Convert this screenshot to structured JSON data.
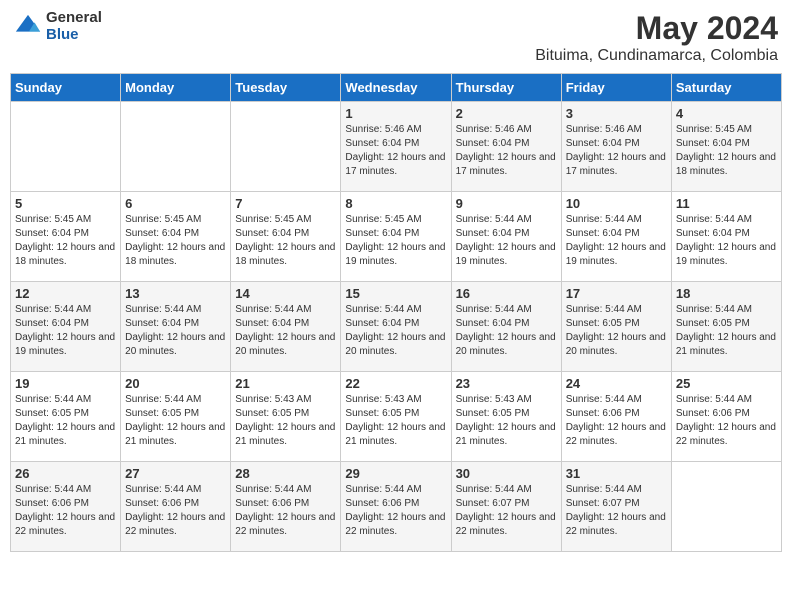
{
  "logo": {
    "general": "General",
    "blue": "Blue"
  },
  "title": "May 2024",
  "subtitle": "Bituima, Cundinamarca, Colombia",
  "days_of_week": [
    "Sunday",
    "Monday",
    "Tuesday",
    "Wednesday",
    "Thursday",
    "Friday",
    "Saturday"
  ],
  "weeks": [
    [
      {
        "day": "",
        "sunrise": "",
        "sunset": "",
        "daylight": ""
      },
      {
        "day": "",
        "sunrise": "",
        "sunset": "",
        "daylight": ""
      },
      {
        "day": "",
        "sunrise": "",
        "sunset": "",
        "daylight": ""
      },
      {
        "day": "1",
        "sunrise": "Sunrise: 5:46 AM",
        "sunset": "Sunset: 6:04 PM",
        "daylight": "Daylight: 12 hours and 17 minutes."
      },
      {
        "day": "2",
        "sunrise": "Sunrise: 5:46 AM",
        "sunset": "Sunset: 6:04 PM",
        "daylight": "Daylight: 12 hours and 17 minutes."
      },
      {
        "day": "3",
        "sunrise": "Sunrise: 5:46 AM",
        "sunset": "Sunset: 6:04 PM",
        "daylight": "Daylight: 12 hours and 17 minutes."
      },
      {
        "day": "4",
        "sunrise": "Sunrise: 5:45 AM",
        "sunset": "Sunset: 6:04 PM",
        "daylight": "Daylight: 12 hours and 18 minutes."
      }
    ],
    [
      {
        "day": "5",
        "sunrise": "Sunrise: 5:45 AM",
        "sunset": "Sunset: 6:04 PM",
        "daylight": "Daylight: 12 hours and 18 minutes."
      },
      {
        "day": "6",
        "sunrise": "Sunrise: 5:45 AM",
        "sunset": "Sunset: 6:04 PM",
        "daylight": "Daylight: 12 hours and 18 minutes."
      },
      {
        "day": "7",
        "sunrise": "Sunrise: 5:45 AM",
        "sunset": "Sunset: 6:04 PM",
        "daylight": "Daylight: 12 hours and 18 minutes."
      },
      {
        "day": "8",
        "sunrise": "Sunrise: 5:45 AM",
        "sunset": "Sunset: 6:04 PM",
        "daylight": "Daylight: 12 hours and 19 minutes."
      },
      {
        "day": "9",
        "sunrise": "Sunrise: 5:44 AM",
        "sunset": "Sunset: 6:04 PM",
        "daylight": "Daylight: 12 hours and 19 minutes."
      },
      {
        "day": "10",
        "sunrise": "Sunrise: 5:44 AM",
        "sunset": "Sunset: 6:04 PM",
        "daylight": "Daylight: 12 hours and 19 minutes."
      },
      {
        "day": "11",
        "sunrise": "Sunrise: 5:44 AM",
        "sunset": "Sunset: 6:04 PM",
        "daylight": "Daylight: 12 hours and 19 minutes."
      }
    ],
    [
      {
        "day": "12",
        "sunrise": "Sunrise: 5:44 AM",
        "sunset": "Sunset: 6:04 PM",
        "daylight": "Daylight: 12 hours and 19 minutes."
      },
      {
        "day": "13",
        "sunrise": "Sunrise: 5:44 AM",
        "sunset": "Sunset: 6:04 PM",
        "daylight": "Daylight: 12 hours and 20 minutes."
      },
      {
        "day": "14",
        "sunrise": "Sunrise: 5:44 AM",
        "sunset": "Sunset: 6:04 PM",
        "daylight": "Daylight: 12 hours and 20 minutes."
      },
      {
        "day": "15",
        "sunrise": "Sunrise: 5:44 AM",
        "sunset": "Sunset: 6:04 PM",
        "daylight": "Daylight: 12 hours and 20 minutes."
      },
      {
        "day": "16",
        "sunrise": "Sunrise: 5:44 AM",
        "sunset": "Sunset: 6:04 PM",
        "daylight": "Daylight: 12 hours and 20 minutes."
      },
      {
        "day": "17",
        "sunrise": "Sunrise: 5:44 AM",
        "sunset": "Sunset: 6:05 PM",
        "daylight": "Daylight: 12 hours and 20 minutes."
      },
      {
        "day": "18",
        "sunrise": "Sunrise: 5:44 AM",
        "sunset": "Sunset: 6:05 PM",
        "daylight": "Daylight: 12 hours and 21 minutes."
      }
    ],
    [
      {
        "day": "19",
        "sunrise": "Sunrise: 5:44 AM",
        "sunset": "Sunset: 6:05 PM",
        "daylight": "Daylight: 12 hours and 21 minutes."
      },
      {
        "day": "20",
        "sunrise": "Sunrise: 5:44 AM",
        "sunset": "Sunset: 6:05 PM",
        "daylight": "Daylight: 12 hours and 21 minutes."
      },
      {
        "day": "21",
        "sunrise": "Sunrise: 5:43 AM",
        "sunset": "Sunset: 6:05 PM",
        "daylight": "Daylight: 12 hours and 21 minutes."
      },
      {
        "day": "22",
        "sunrise": "Sunrise: 5:43 AM",
        "sunset": "Sunset: 6:05 PM",
        "daylight": "Daylight: 12 hours and 21 minutes."
      },
      {
        "day": "23",
        "sunrise": "Sunrise: 5:43 AM",
        "sunset": "Sunset: 6:05 PM",
        "daylight": "Daylight: 12 hours and 21 minutes."
      },
      {
        "day": "24",
        "sunrise": "Sunrise: 5:44 AM",
        "sunset": "Sunset: 6:06 PM",
        "daylight": "Daylight: 12 hours and 22 minutes."
      },
      {
        "day": "25",
        "sunrise": "Sunrise: 5:44 AM",
        "sunset": "Sunset: 6:06 PM",
        "daylight": "Daylight: 12 hours and 22 minutes."
      }
    ],
    [
      {
        "day": "26",
        "sunrise": "Sunrise: 5:44 AM",
        "sunset": "Sunset: 6:06 PM",
        "daylight": "Daylight: 12 hours and 22 minutes."
      },
      {
        "day": "27",
        "sunrise": "Sunrise: 5:44 AM",
        "sunset": "Sunset: 6:06 PM",
        "daylight": "Daylight: 12 hours and 22 minutes."
      },
      {
        "day": "28",
        "sunrise": "Sunrise: 5:44 AM",
        "sunset": "Sunset: 6:06 PM",
        "daylight": "Daylight: 12 hours and 22 minutes."
      },
      {
        "day": "29",
        "sunrise": "Sunrise: 5:44 AM",
        "sunset": "Sunset: 6:06 PM",
        "daylight": "Daylight: 12 hours and 22 minutes."
      },
      {
        "day": "30",
        "sunrise": "Sunrise: 5:44 AM",
        "sunset": "Sunset: 6:07 PM",
        "daylight": "Daylight: 12 hours and 22 minutes."
      },
      {
        "day": "31",
        "sunrise": "Sunrise: 5:44 AM",
        "sunset": "Sunset: 6:07 PM",
        "daylight": "Daylight: 12 hours and 22 minutes."
      },
      {
        "day": "",
        "sunrise": "",
        "sunset": "",
        "daylight": ""
      }
    ]
  ]
}
